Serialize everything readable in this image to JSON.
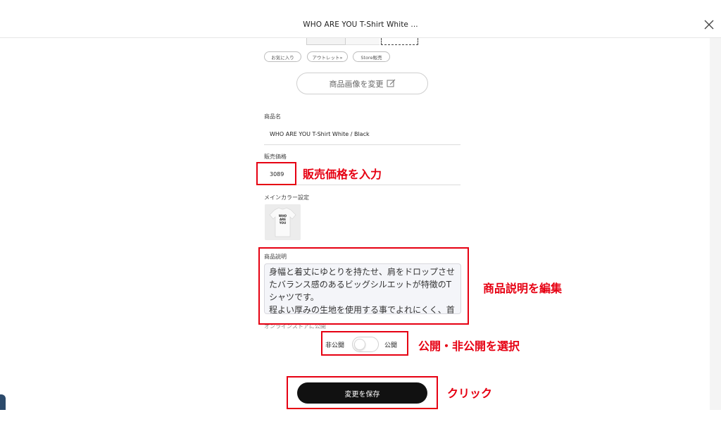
{
  "header": {
    "title": "WHO ARE YOU T-Shirt White ..."
  },
  "tags": [
    "お気に入り",
    "アウトレット»",
    "Store販売"
  ],
  "change_image_button": "商品画像を変更",
  "product_name": {
    "label": "商品名",
    "value": "WHO ARE YOU T-Shirt White / Black"
  },
  "price": {
    "label": "販売価格",
    "value": "3089"
  },
  "main_color": {
    "label": "メインカラー設定",
    "thumb_text": [
      "WHO",
      "ARE",
      "YOU"
    ]
  },
  "description": {
    "label": "商品説明",
    "value": "身幅と着丈にゆとりを持たせ、肩をドロップさせたバランス感のあるビッグシルエットが特徴のTシャツです。\n程よい厚みの生地を使用する事でよれにくく、首リ"
  },
  "online_store": {
    "label": "オンラインストアに公開",
    "off_label": "非公開",
    "on_label": "公開",
    "enabled": false
  },
  "save_button": "変更を保存",
  "annotations": {
    "price": "販売価格を入力",
    "description": "商品説明を編集",
    "visibility": "公開・非公開を選択",
    "save": "クリック"
  },
  "colors": {
    "annotation": "#e60012",
    "save_button_bg": "#111111"
  }
}
